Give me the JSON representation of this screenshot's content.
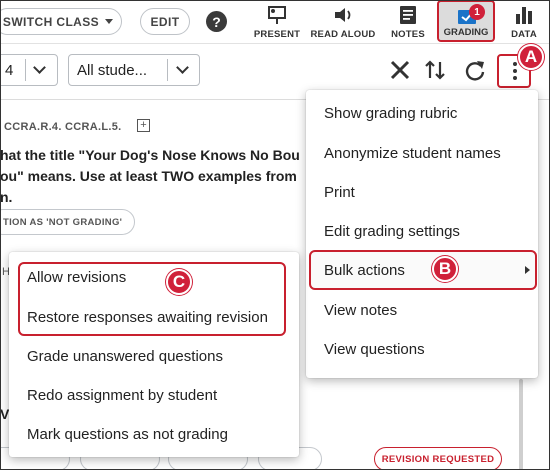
{
  "toolbar": {
    "switch_class": "SWITCH CLASS",
    "edit": "EDIT",
    "help_glyph": "?",
    "tools": [
      {
        "label": "PRESENT",
        "icon": "present-icon"
      },
      {
        "label": "READ ALOUD",
        "icon": "speaker-icon"
      },
      {
        "label": "NOTES",
        "icon": "notes-icon"
      },
      {
        "label": "GRADING",
        "icon": "grading-icon",
        "badge": "1",
        "active": true
      },
      {
        "label": "DATA",
        "icon": "bar-chart-icon"
      }
    ]
  },
  "filters": {
    "first_select_value": "4",
    "student_select_value": "All stude..."
  },
  "content": {
    "standards": "CCRA.R.4.   CCRA.L.5.",
    "question_lines": [
      "hat the title \"Your Dog's Nose Knows No Bou",
      "ou\" means. Use at least TWO examples from",
      "n."
    ],
    "mark_pill": "TION AS 'NOT GRADING'",
    "fragment_h": "H",
    "fragment_w": "V",
    "revision_requested": "REVISION REQUESTED"
  },
  "more_menu": {
    "items": [
      "Show grading rubric",
      "Anonymize student names",
      "Print",
      "Edit grading settings",
      "Bulk actions",
      "View notes",
      "View questions"
    ]
  },
  "bulk_submenu": {
    "items": [
      "Allow revisions",
      "Restore responses awaiting revision",
      "Grade unanswered questions",
      "Redo assignment by student",
      "Mark questions as not grading"
    ]
  },
  "callouts": {
    "a": "A",
    "b": "B",
    "c": "C"
  },
  "colors": {
    "accent_red": "#c8202e",
    "grading_blue": "#1a73c8"
  }
}
